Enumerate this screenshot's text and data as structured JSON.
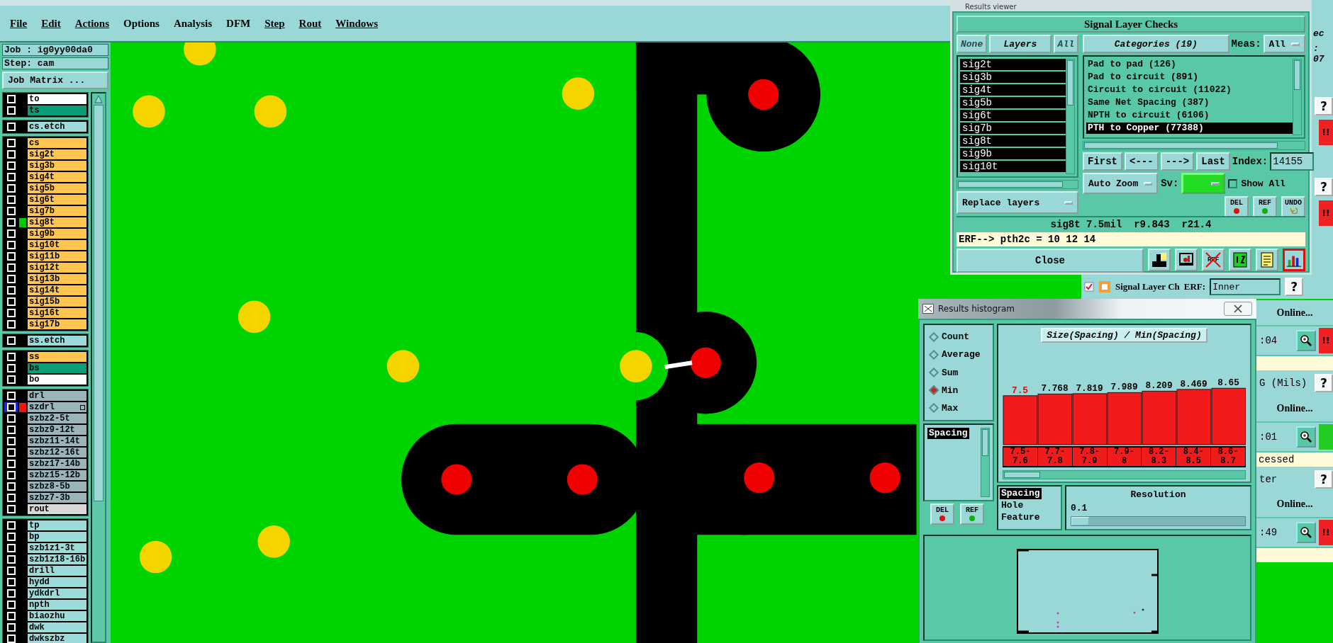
{
  "menu": [
    {
      "label": "File",
      "underlined": true
    },
    {
      "label": "Edit",
      "underlined": true
    },
    {
      "label": "Actions",
      "underlined": true
    },
    {
      "label": "Options",
      "underlined": false
    },
    {
      "label": "Analysis",
      "underlined": false
    },
    {
      "label": "DFM",
      "underlined": false
    },
    {
      "label": "Step",
      "underlined": true
    },
    {
      "label": "Rout",
      "underlined": true
    },
    {
      "label": "Windows",
      "underlined": true
    }
  ],
  "job": {
    "job_label": "Job : ig0yy00da0",
    "step_label": "Step: cam",
    "matrix_button": "Job Matrix ..."
  },
  "layer_groups": [
    {
      "rows": [
        {
          "name": "to",
          "kind": "overlay",
          "checked": false,
          "focused": false
        },
        {
          "name": "ts",
          "kind": "mask",
          "checked": false,
          "focused": false
        }
      ]
    },
    {
      "rows": [
        {
          "name": "cs.etch",
          "kind": "etch",
          "checked": false,
          "focused": false
        }
      ]
    },
    {
      "rows": [
        {
          "name": "cs",
          "kind": "signal",
          "checked": false,
          "focused": false
        },
        {
          "name": "sig2t",
          "kind": "signal",
          "checked": false,
          "focused": false
        },
        {
          "name": "sig3b",
          "kind": "signal",
          "checked": false,
          "focused": false
        },
        {
          "name": "sig4t",
          "kind": "signal",
          "checked": false,
          "focused": false
        },
        {
          "name": "sig5b",
          "kind": "signal",
          "checked": false,
          "focused": false
        },
        {
          "name": "sig6t",
          "kind": "signal",
          "checked": false,
          "focused": false
        },
        {
          "name": "sig7b",
          "kind": "signal",
          "checked": false,
          "focused": false
        },
        {
          "name": "sig8t",
          "kind": "signal",
          "checked": false,
          "focused": false,
          "color": "#00cc00"
        },
        {
          "name": "sig9b",
          "kind": "signal",
          "checked": false,
          "focused": false
        },
        {
          "name": "sig10t",
          "kind": "signal",
          "checked": false,
          "focused": false
        },
        {
          "name": "sig11b",
          "kind": "signal",
          "checked": false,
          "focused": false
        },
        {
          "name": "sig12t",
          "kind": "signal",
          "checked": false,
          "focused": false
        },
        {
          "name": "sig13b",
          "kind": "signal",
          "checked": false,
          "focused": false
        },
        {
          "name": "sig14t",
          "kind": "signal",
          "checked": false,
          "focused": false
        },
        {
          "name": "sig15b",
          "kind": "signal",
          "checked": false,
          "focused": false
        },
        {
          "name": "sig16t",
          "kind": "signal",
          "checked": false,
          "focused": false
        },
        {
          "name": "sig17b",
          "kind": "signal",
          "checked": false,
          "focused": false
        }
      ]
    },
    {
      "rows": [
        {
          "name": "ss.etch",
          "kind": "etch",
          "checked": false,
          "focused": false
        }
      ]
    },
    {
      "rows": [
        {
          "name": "ss",
          "kind": "signal",
          "checked": false,
          "focused": false
        },
        {
          "name": "bs",
          "kind": "mask",
          "checked": false,
          "focused": false
        },
        {
          "name": "bo",
          "kind": "overlay",
          "checked": false,
          "focused": false
        }
      ]
    },
    {
      "rows": [
        {
          "name": "drl",
          "kind": "drill",
          "checked": false,
          "focused": false
        },
        {
          "name": "szdrl",
          "kind": "drill",
          "checked": false,
          "focused": true,
          "color": "#ff1010"
        },
        {
          "name": "szbz2-5t",
          "kind": "drill",
          "checked": false,
          "focused": false
        },
        {
          "name": "szbz9-12t",
          "kind": "drill",
          "checked": false,
          "focused": false
        },
        {
          "name": "szbz11-14t",
          "kind": "drill",
          "checked": false,
          "focused": false
        },
        {
          "name": "szbz12-16t",
          "kind": "drill",
          "checked": false,
          "focused": false
        },
        {
          "name": "szbz17-14b",
          "kind": "drill",
          "checked": false,
          "focused": false
        },
        {
          "name": "szbz15-12b",
          "kind": "drill",
          "checked": false,
          "focused": false
        },
        {
          "name": "szbz8-5b",
          "kind": "drill",
          "checked": false,
          "focused": false
        },
        {
          "name": "szbz7-3b",
          "kind": "drill",
          "checked": false,
          "focused": false
        },
        {
          "name": "rout",
          "kind": "rout",
          "checked": false,
          "focused": false
        }
      ]
    },
    {
      "rows": [
        {
          "name": "tp",
          "kind": "document",
          "checked": false,
          "focused": false
        },
        {
          "name": "bp",
          "kind": "document",
          "checked": false,
          "focused": false
        },
        {
          "name": "szb1z1-3t",
          "kind": "document",
          "checked": false,
          "focused": false
        },
        {
          "name": "szb1z18-16b",
          "kind": "document",
          "checked": false,
          "focused": false
        },
        {
          "name": "drill",
          "kind": "document",
          "checked": false,
          "focused": false
        },
        {
          "name": "hydd",
          "kind": "document",
          "checked": false,
          "focused": false
        },
        {
          "name": "ydkdrl",
          "kind": "document",
          "checked": false,
          "focused": false
        },
        {
          "name": "npth",
          "kind": "document",
          "checked": false,
          "focused": false
        },
        {
          "name": "biaozhu",
          "kind": "document",
          "checked": false,
          "focused": false
        },
        {
          "name": "dwk",
          "kind": "document",
          "checked": false,
          "focused": false
        },
        {
          "name": "dwkszbz",
          "kind": "document",
          "checked": false,
          "focused": false
        }
      ]
    }
  ],
  "results_viewer": {
    "title": "Results viewer",
    "heading": "Signal Layer Checks",
    "layer_buttons": [
      {
        "label": "None",
        "kind": "action"
      },
      {
        "label": "Layers",
        "kind": "title"
      },
      {
        "label": "All",
        "kind": "action"
      }
    ],
    "layers": [
      {
        "name": "sig2t",
        "selected": true
      },
      {
        "name": "sig3b",
        "selected": true
      },
      {
        "name": "sig4t",
        "selected": true
      },
      {
        "name": "sig5b",
        "selected": true
      },
      {
        "name": "sig6t",
        "selected": true
      },
      {
        "name": "sig7b",
        "selected": true
      },
      {
        "name": "sig8t",
        "selected": true
      },
      {
        "name": "sig9b",
        "selected": true
      },
      {
        "name": "sig10t",
        "selected": true
      }
    ],
    "categories_header": "Categories (19)",
    "meas_label": "Meas:",
    "meas_value": "All",
    "categories": [
      {
        "label": "Pad to pad (126)",
        "selected": false
      },
      {
        "label": "Pad to circuit (891)",
        "selected": false
      },
      {
        "label": "Circuit to circuit (11022)",
        "selected": false
      },
      {
        "label": "Same Net Spacing (387)",
        "selected": false
      },
      {
        "label": "NPTH to circuit (6106)",
        "selected": false
      },
      {
        "label": "PTH to Copper (77388)",
        "selected": true
      }
    ],
    "nav_buttons": [
      "First",
      "<---",
      "--->",
      "Last"
    ],
    "index_label": "Index:",
    "index_value": "14155",
    "zoom_mode": "Auto Zoom",
    "sv_label": "Sv:",
    "show_all": {
      "label": "Show All",
      "checked": false
    },
    "replace_mode": "Replace layers",
    "action_buttons": [
      {
        "label": "DEL",
        "kind": "delete"
      },
      {
        "label": "REF",
        "kind": "ref"
      },
      {
        "label": "UNDO",
        "kind": "undo"
      }
    ],
    "status": "sig8t 7.5mil  r9.843  r21.4",
    "erf_line": "ERF--> pth2c = 10 12 14",
    "close": "Close",
    "tools": [
      {
        "kind": "layers",
        "selected": false
      },
      {
        "kind": "display",
        "selected": false
      },
      {
        "kind": "ref_cross",
        "label": "REF",
        "selected": false
      },
      {
        "kind": "numbers",
        "selected": false
      },
      {
        "kind": "report",
        "selected": false
      },
      {
        "kind": "histogram",
        "selected": true
      }
    ]
  },
  "histogram": {
    "title": "Results histogram",
    "modes": [
      {
        "label": "Count",
        "selected": false
      },
      {
        "label": "Average",
        "selected": false
      },
      {
        "label": "Sum",
        "selected": false
      },
      {
        "label": "Min",
        "selected": true
      },
      {
        "label": "Max",
        "selected": false
      }
    ],
    "fields": [
      {
        "label": "Spacing",
        "selected": true
      }
    ],
    "list_buttons": [
      {
        "label": "DEL",
        "kind": "delete"
      },
      {
        "label": "REF",
        "kind": "ref"
      }
    ],
    "chart_data": {
      "type": "bar",
      "title": "Size(Spacing) / Min(Spacing)",
      "categories": [
        "7.5-7.6",
        "7.7-7.8",
        "7.8-7.9",
        "7.9-8",
        "8.2-8.3",
        "8.4-8.5",
        "8.6-8.7"
      ],
      "values": [
        7.5,
        7.768,
        7.819,
        7.989,
        8.209,
        8.469,
        8.65
      ],
      "data_labels": true
    },
    "bins": [
      {
        "selected": true
      },
      {
        "selected": false
      },
      {
        "selected": false
      },
      {
        "selected": false
      },
      {
        "selected": false
      },
      {
        "selected": false
      },
      {
        "selected": false
      }
    ],
    "measures": [
      {
        "label": "Spacing",
        "selected": true
      },
      {
        "label": "Hole",
        "selected": false
      },
      {
        "label": "Feature",
        "selected": false
      }
    ],
    "resolution": {
      "label": "Resolution",
      "value": "0.1",
      "level": 0.1
    }
  },
  "background_window": {
    "top_items": [
      {
        "kind": "text",
        "text": "ec"
      },
      {
        "kind": "text",
        "text": ": 07"
      },
      {
        "kind": "help",
        "text": "?"
      },
      {
        "kind": "alert",
        "text": "!!",
        "color": "#ee2222"
      },
      {
        "kind": "help",
        "text": "?"
      },
      {
        "kind": "alert",
        "text": "!!",
        "color": "#ee2222"
      }
    ],
    "header": {
      "title": "Signal Layer Ch",
      "erf_label": "ERF:",
      "erf_value": "Inner",
      "help": "?"
    },
    "rows": [
      {
        "kind": "online",
        "text": "Online..."
      },
      {
        "kind": "run",
        "text": ":04",
        "alert": "!!",
        "color": "#ee2222"
      },
      {
        "kind": "note"
      },
      {
        "kind": "help",
        "text": "G (Mils)",
        "help": "?"
      },
      {
        "kind": "online",
        "text": "Online..."
      },
      {
        "kind": "run",
        "text": ":01",
        "color": "#22cc22"
      },
      {
        "kind": "note",
        "text": "cessed"
      },
      {
        "kind": "help",
        "text": "ter",
        "help": "?"
      },
      {
        "kind": "online",
        "text": "Online..."
      },
      {
        "kind": "run",
        "text": ":49",
        "alert": "!!",
        "color": "#ee2222"
      },
      {
        "kind": "note"
      }
    ]
  }
}
